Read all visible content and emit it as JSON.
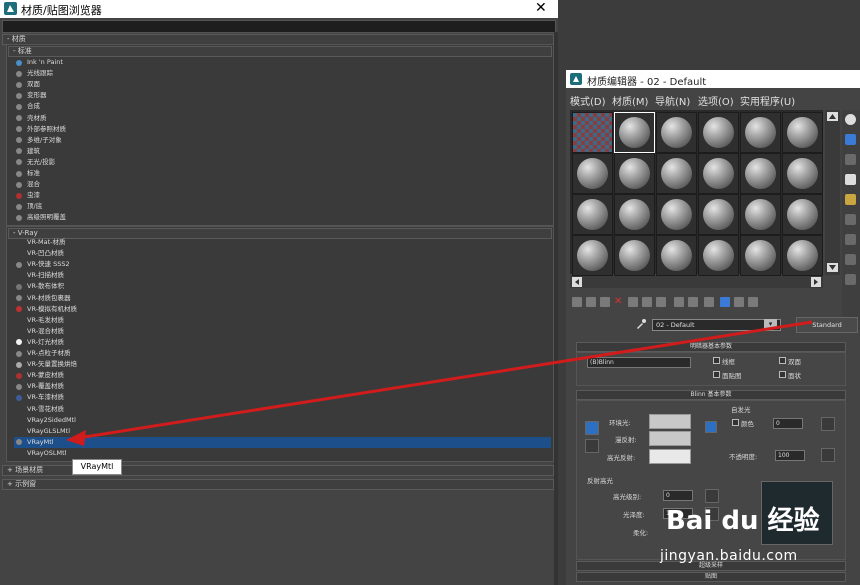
{
  "browser": {
    "title": "材质/贴图浏览器",
    "close_glyph": "✕",
    "search_value": "",
    "section_materials": "- 材质",
    "group_standard": "- 标准",
    "standard_items": [
      {
        "label": "Ink 'n Paint",
        "icon": "#4a8fc7"
      },
      {
        "label": "光线跟踪",
        "icon": "#888888"
      },
      {
        "label": "双面",
        "icon": "#888888"
      },
      {
        "label": "变形器",
        "icon": "#888888"
      },
      {
        "label": "合成",
        "icon": "#888888"
      },
      {
        "label": "壳材质",
        "icon": "#888888"
      },
      {
        "label": "外部参照材质",
        "icon": "#888888"
      },
      {
        "label": "多维/子对象",
        "icon": "#888888"
      },
      {
        "label": "建筑",
        "icon": "#888888"
      },
      {
        "label": "无光/投影",
        "icon": "#888888"
      },
      {
        "label": "标准",
        "icon": "#888888"
      },
      {
        "label": "混合",
        "icon": "#888888"
      },
      {
        "label": "虫漆",
        "icon": "#b03030"
      },
      {
        "label": "顶/底",
        "icon": "#888888"
      },
      {
        "label": "高级照明覆盖",
        "icon": "#888888"
      }
    ],
    "group_vray": "- V-Ray",
    "vray_items": [
      {
        "label": "VR-Mat-材质",
        "icon": "#3a3a3a"
      },
      {
        "label": "VR-凹凸材质",
        "icon": "#3a3a3a"
      },
      {
        "label": "VR-快速 SSS2",
        "icon": "#888888"
      },
      {
        "label": "VR-扫描材质",
        "icon": "#3a3a3a"
      },
      {
        "label": "VR-散布体积",
        "icon": "#777777"
      },
      {
        "label": "VR-材质包裹器",
        "icon": "#888888"
      },
      {
        "label": "VR-模拟有机材质",
        "icon": "#c03030"
      },
      {
        "label": "VR-毛发材质",
        "icon": "#3a3a3a"
      },
      {
        "label": "VR-混合材质",
        "icon": "#3a3a3a"
      },
      {
        "label": "VR-灯光材质",
        "icon": "#f2f2f2"
      },
      {
        "label": "VR-点粒子材质",
        "icon": "#888888"
      },
      {
        "label": "VR-矢量置换烘焙",
        "icon": "#aaaaaa"
      },
      {
        "label": "VR-蒙皮材质",
        "icon": "#b03030"
      },
      {
        "label": "VR-覆盖材质",
        "icon": "#888888"
      },
      {
        "label": "VR-车漆材质",
        "icon": "#3c5c9c"
      },
      {
        "label": "VR-雪花材质",
        "icon": "#3a3a3a"
      },
      {
        "label": "VRay2SidedMtl",
        "icon": "#3a3a3a"
      },
      {
        "label": "VRayGLSLMtl",
        "icon": "#3a3a3a"
      },
      {
        "label": "VRayMtl",
        "icon": "#888888"
      },
      {
        "label": "VRayOSLMtl",
        "icon": "#3a3a3a"
      }
    ],
    "section_scene": "+ 场景材质",
    "section_sample": "+ 示例窗",
    "tooltip": "VRayMtl",
    "selected_color": "#1d4f8a",
    "arrow_color": "#d21c1c"
  },
  "editor": {
    "title": "材质编辑器 - 02 - Default",
    "menus": [
      "模式(D)",
      "材质(M)",
      "导航(N)",
      "选项(O)",
      "实用程序(U)"
    ],
    "material_name": "02 - Default",
    "type_button": "Standard",
    "shader_rollout": "明暗器基本参数",
    "shader_type": "(B)Blinn",
    "shader_options": [
      "线框",
      "双面",
      "面贴图",
      "面状"
    ],
    "blinn_rollout": "Blinn 基本参数",
    "self_illum_label": "自发光",
    "self_illum_color_label": "颜色",
    "self_illum_value": "0",
    "ambient_label": "环境光:",
    "diffuse_label": "漫反射:",
    "specular_label": "高光反射:",
    "opacity_label": "不透明度:",
    "opacity_value": "100",
    "spec_highlights_label": "反射高光",
    "spec_level_label": "高光级别:",
    "spec_level_value": "0",
    "glossiness_label": "光泽度:",
    "glossiness_value": "10",
    "soften_label": "柔化:",
    "extended_rollout": "超级采样",
    "maps_rollout": "贴图"
  },
  "watermark": {
    "logo": "Bai du 经验",
    "url": "jingyan.baidu.com"
  }
}
